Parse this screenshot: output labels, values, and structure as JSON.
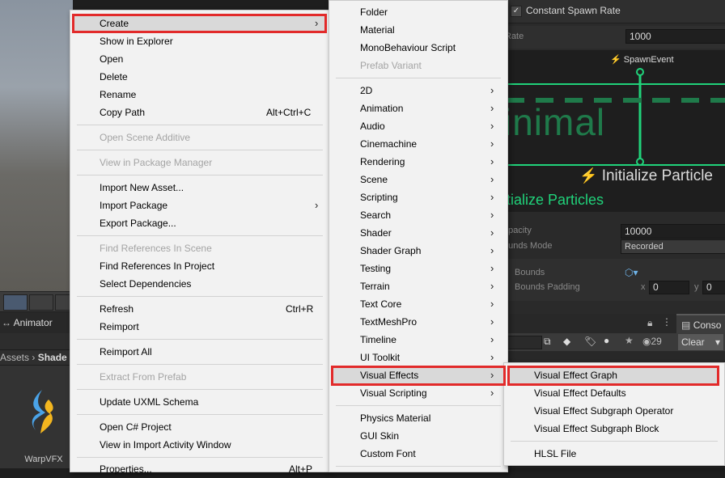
{
  "background": {
    "right_panel": {
      "constant_spawn_rate_label": "Constant Spawn Rate",
      "rate_label": "Rate",
      "rate_value": "1000",
      "spawn_event_label": "SpawnEvent",
      "minimal_text": "inimal",
      "initialize_particle_title": "Initialize Particle",
      "initialize_particles_label": "itialize Particles",
      "capacity_label": "apacity",
      "capacity_value": "10000",
      "bounds_mode_label": "ounds Mode",
      "bounds_mode_value": "Recorded",
      "bounds_label": "Bounds",
      "bounds_padding_label": "Bounds Padding",
      "x_label": "x",
      "x_value": "0",
      "y_label": "y",
      "y_value": "0",
      "console_tab": "Conso",
      "clear_button": "Clear",
      "count": "29"
    },
    "left": {
      "animator_tab": "Animator",
      "breadcrumb_assets": "Assets",
      "breadcrumb_shader": "Shade",
      "asset_name": "WarpVFX"
    }
  },
  "context_menu": {
    "items": [
      {
        "label": "Create",
        "has_submenu": true
      },
      {
        "label": "Show in Explorer"
      },
      {
        "label": "Open"
      },
      {
        "label": "Delete"
      },
      {
        "label": "Rename"
      },
      {
        "label": "Copy Path",
        "shortcut": "Alt+Ctrl+C"
      },
      {
        "label": "Open Scene Additive",
        "disabled": true
      },
      {
        "label": "View in Package Manager",
        "disabled": true
      },
      {
        "label": "Import New Asset..."
      },
      {
        "label": "Import Package",
        "has_submenu": true
      },
      {
        "label": "Export Package..."
      },
      {
        "label": "Find References In Scene",
        "disabled": true
      },
      {
        "label": "Find References In Project"
      },
      {
        "label": "Select Dependencies"
      },
      {
        "label": "Refresh",
        "shortcut": "Ctrl+R"
      },
      {
        "label": "Reimport"
      },
      {
        "label": "Reimport All"
      },
      {
        "label": "Extract From Prefab",
        "disabled": true
      },
      {
        "label": "Update UXML Schema"
      },
      {
        "label": "Open C# Project"
      },
      {
        "label": "View in Import Activity Window"
      },
      {
        "label": "Properties...",
        "shortcut": "Alt+P"
      }
    ]
  },
  "create_menu": {
    "items": [
      {
        "label": "Folder"
      },
      {
        "label": "Material"
      },
      {
        "label": "MonoBehaviour Script"
      },
      {
        "label": "Prefab Variant",
        "disabled": true
      },
      {
        "label": "2D",
        "has_submenu": true
      },
      {
        "label": "Animation",
        "has_submenu": true
      },
      {
        "label": "Audio",
        "has_submenu": true
      },
      {
        "label": "Cinemachine",
        "has_submenu": true
      },
      {
        "label": "Rendering",
        "has_submenu": true
      },
      {
        "label": "Scene",
        "has_submenu": true
      },
      {
        "label": "Scripting",
        "has_submenu": true
      },
      {
        "label": "Search",
        "has_submenu": true
      },
      {
        "label": "Shader",
        "has_submenu": true
      },
      {
        "label": "Shader Graph",
        "has_submenu": true
      },
      {
        "label": "Testing",
        "has_submenu": true
      },
      {
        "label": "Terrain",
        "has_submenu": true
      },
      {
        "label": "Text Core",
        "has_submenu": true
      },
      {
        "label": "TextMeshPro",
        "has_submenu": true
      },
      {
        "label": "Timeline",
        "has_submenu": true
      },
      {
        "label": "UI Toolkit",
        "has_submenu": true
      },
      {
        "label": "Visual Effects",
        "has_submenu": true
      },
      {
        "label": "Visual Scripting",
        "has_submenu": true
      },
      {
        "label": "Physics Material"
      },
      {
        "label": "GUI Skin"
      },
      {
        "label": "Custom Font"
      }
    ]
  },
  "visual_effects_menu": {
    "items": [
      {
        "label": "Visual Effect Graph"
      },
      {
        "label": "Visual Effect Defaults"
      },
      {
        "label": "Visual Effect Subgraph Operator"
      },
      {
        "label": "Visual Effect Subgraph Block"
      },
      {
        "label": "HLSL File"
      }
    ]
  },
  "colors": {
    "highlight_border": "#e22a2a",
    "menu_bg": "#f2f2f2",
    "accent_green": "#20d27a"
  }
}
